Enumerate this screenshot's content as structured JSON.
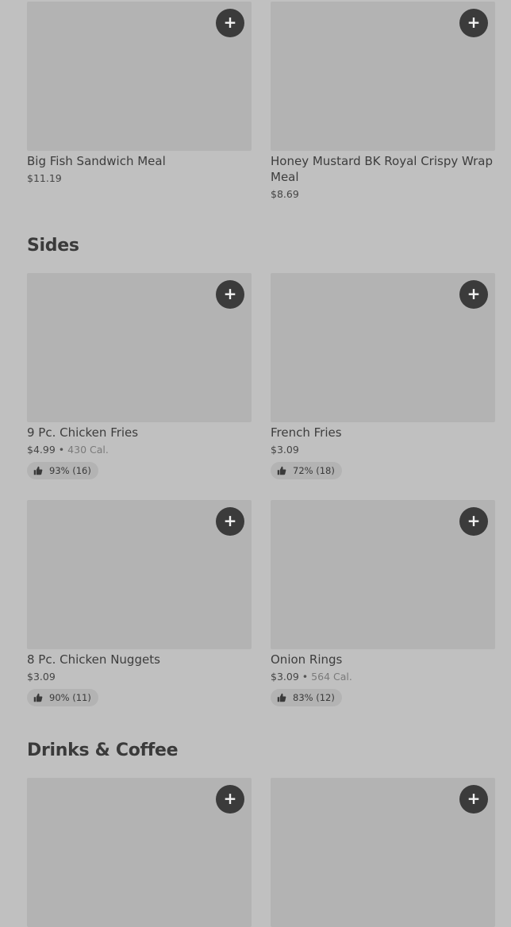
{
  "sections": [
    {
      "title": "",
      "items": [
        {
          "name": "Big Fish Sandwich Meal",
          "price": "$11.19"
        },
        {
          "name": "Honey Mustard BK Royal Crispy Wrap Meal",
          "price": "$8.69"
        }
      ]
    },
    {
      "title": "Sides",
      "items": [
        {
          "name": "9 Pc. Chicken Fries",
          "price": "$4.99",
          "calories": "430 Cal.",
          "rating": "93% (16)"
        },
        {
          "name": "French Fries",
          "price": "$3.09",
          "rating": "72% (18)"
        },
        {
          "name": "8 Pc. Chicken Nuggets",
          "price": "$3.09",
          "rating": "90% (11)"
        },
        {
          "name": "Onion Rings",
          "price": "$3.09",
          "calories": "564 Cal.",
          "rating": "83% (12)"
        }
      ]
    },
    {
      "title": "Drinks & Coffee",
      "items": []
    }
  ],
  "ui": {
    "add_icon": "plus-icon",
    "rating_icon": "thumbs-up-icon",
    "separator": "•",
    "add_symbol": "+"
  }
}
